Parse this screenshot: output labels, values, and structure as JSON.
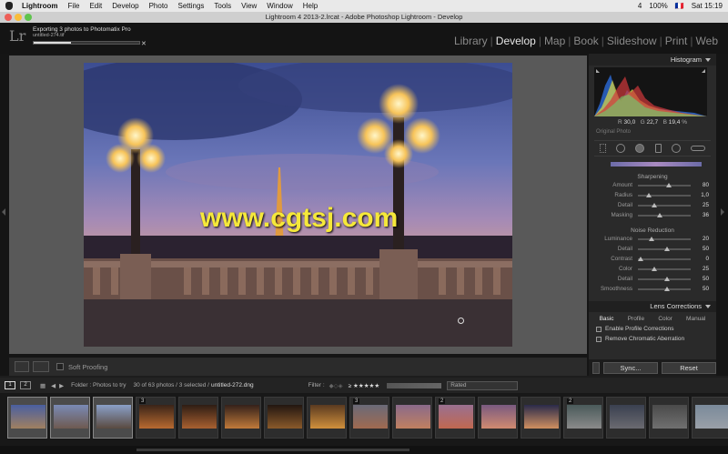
{
  "menubar": {
    "items": [
      "Lightroom",
      "File",
      "Edit",
      "Develop",
      "Photo",
      "Settings",
      "Tools",
      "View",
      "Window",
      "Help"
    ],
    "status": {
      "notif": "4",
      "battery": "100%",
      "flag": "🇫🇷",
      "clock": "Sat 15:19"
    }
  },
  "window": {
    "title": "Lightroom 4 2013-2.lrcat - Adobe Photoshop Lightroom - Develop"
  },
  "identity": {
    "logo": "Lr",
    "export_title": "Exporting 3 photos to Photomatix Pro",
    "export_file": "untitled-274.tif",
    "export_progress": 0.35
  },
  "modules": [
    "Library",
    "Develop",
    "Map",
    "Book",
    "Slideshow",
    "Print",
    "Web"
  ],
  "active_module": "Develop",
  "photo": {
    "watermark": "www.cgtsj.com"
  },
  "toolbar": {
    "soft_proofing": "Soft Proofing"
  },
  "histogram": {
    "title": "Histogram",
    "r_label": "R",
    "r": "30,0",
    "g_label": "G",
    "g": "22,7",
    "b_label": "B",
    "b": "19,4",
    "pct": "%",
    "original_photo": "Original Photo"
  },
  "detail": {
    "sharpening_title": "Sharpening",
    "sharpening": [
      {
        "label": "Amount",
        "value": "80",
        "pos": 0.53
      },
      {
        "label": "Radius",
        "value": "1,0",
        "pos": 0.15
      },
      {
        "label": "Detail",
        "value": "25",
        "pos": 0.25
      },
      {
        "label": "Masking",
        "value": "36",
        "pos": 0.36
      }
    ],
    "noise_title": "Noise Reduction",
    "noise": [
      {
        "label": "Luminance",
        "value": "20",
        "pos": 0.2
      },
      {
        "label": "Detail",
        "value": "50",
        "pos": 0.5
      },
      {
        "label": "Contrast",
        "value": "0",
        "pos": 0.0
      },
      {
        "label": "Color",
        "value": "25",
        "pos": 0.25
      },
      {
        "label": "Detail",
        "value": "50",
        "pos": 0.5
      },
      {
        "label": "Smoothness",
        "value": "50",
        "pos": 0.5
      }
    ]
  },
  "lens": {
    "title": "Lens Corrections",
    "tabs": [
      "Basic",
      "Profile",
      "Color",
      "Manual"
    ],
    "options": [
      "Enable Profile Corrections",
      "Remove Chromatic Aberration"
    ]
  },
  "sync": {
    "sync_label": "Sync...",
    "reset_label": "Reset"
  },
  "filmbar": {
    "page1": "1",
    "page2": "2",
    "folder": "Folder : Photos to try",
    "count": "30 of 63 photos / 3 selected /",
    "file": "untitled-272.dng",
    "filter_label": "Filter :",
    "filter_value": "Rated"
  },
  "thumbs": [
    {
      "num": "",
      "sel": true,
      "c1": "#4a5fa0",
      "c2": "#a08060"
    },
    {
      "num": "",
      "sel": true,
      "c1": "#7a8ab5",
      "c2": "#6e5a50"
    },
    {
      "num": "",
      "sel": true,
      "c1": "#8aa0c8",
      "c2": "#5a4a40"
    },
    {
      "num": "3",
      "sel": false,
      "c1": "#3a2418",
      "c2": "#b86a30"
    },
    {
      "num": "",
      "sel": false,
      "c1": "#2e1d14",
      "c2": "#a86030"
    },
    {
      "num": "",
      "sel": false,
      "c1": "#34211a",
      "c2": "#c07a3a"
    },
    {
      "num": "",
      "sel": false,
      "c1": "#221610",
      "c2": "#8a5a2a"
    },
    {
      "num": "",
      "sel": false,
      "c1": "#5a3a20",
      "c2": "#d0903c"
    },
    {
      "num": "3",
      "sel": false,
      "c1": "#6a6a78",
      "c2": "#a06a50"
    },
    {
      "num": "",
      "sel": false,
      "c1": "#8a6a8a",
      "c2": "#c08060"
    },
    {
      "num": "2",
      "sel": false,
      "c1": "#9a7090",
      "c2": "#c06850"
    },
    {
      "num": "",
      "sel": false,
      "c1": "#7a5a80",
      "c2": "#d08a70"
    },
    {
      "num": "",
      "sel": false,
      "c1": "#2a2a4a",
      "c2": "#d09060"
    },
    {
      "num": "2",
      "sel": false,
      "c1": "#4a5a5a",
      "c2": "#8a8a8a"
    },
    {
      "num": "",
      "sel": false,
      "c1": "#3a4050",
      "c2": "#6a6a70"
    },
    {
      "num": "",
      "sel": false,
      "c1": "#4a4a4a",
      "c2": "#707070"
    },
    {
      "num": "",
      "sel": false,
      "c1": "#7a8a9a",
      "c2": "#9aa0a8"
    }
  ]
}
